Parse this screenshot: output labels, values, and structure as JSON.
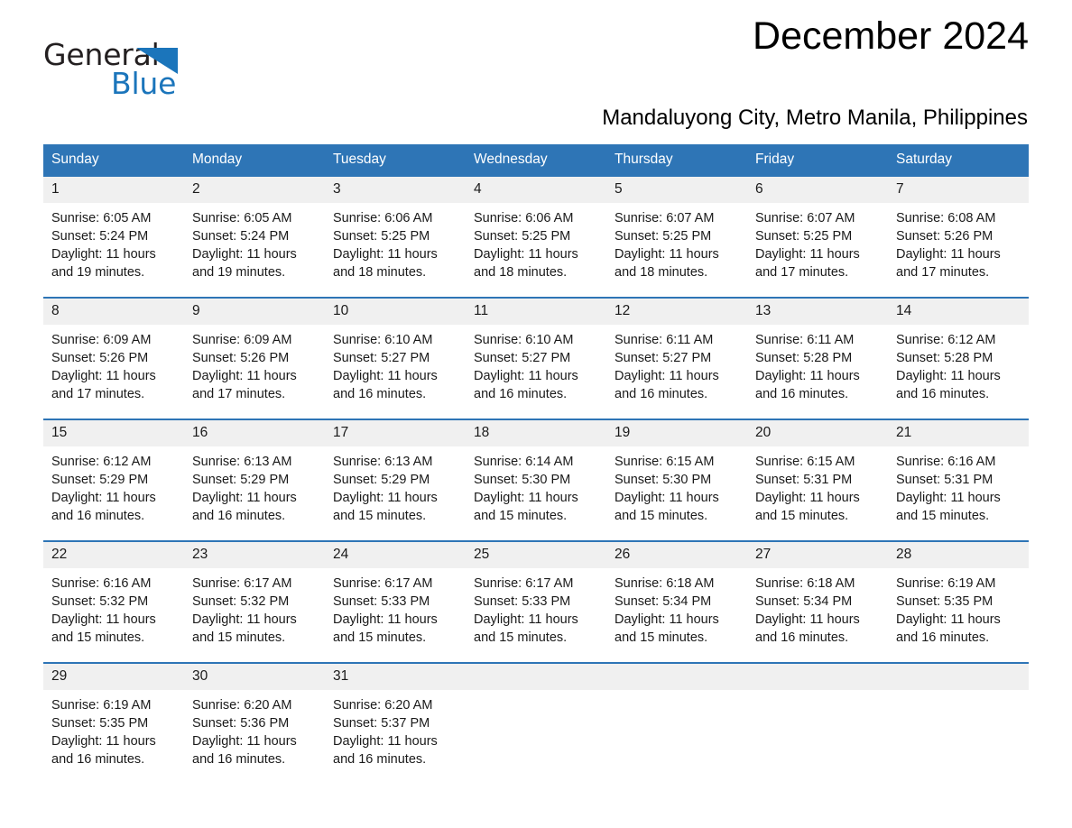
{
  "brand": {
    "name_part1": "General",
    "name_part2": "Blue",
    "logo_icon": "triangle-logo-icon",
    "accent_color": "#1b75bb"
  },
  "header": {
    "title": "December 2024",
    "subtitle": "Mandaluyong City, Metro Manila, Philippines"
  },
  "colors": {
    "header_blue": "#2e75b6",
    "daynum_band": "#f0f0f0",
    "text": "#1a1a1a"
  },
  "calendar": {
    "weekday_headers": [
      "Sunday",
      "Monday",
      "Tuesday",
      "Wednesday",
      "Thursday",
      "Friday",
      "Saturday"
    ],
    "weeks": [
      [
        {
          "day": "1",
          "sunrise": "Sunrise: 6:05 AM",
          "sunset": "Sunset: 5:24 PM",
          "daylight": "Daylight: 11 hours and 19 minutes."
        },
        {
          "day": "2",
          "sunrise": "Sunrise: 6:05 AM",
          "sunset": "Sunset: 5:24 PM",
          "daylight": "Daylight: 11 hours and 19 minutes."
        },
        {
          "day": "3",
          "sunrise": "Sunrise: 6:06 AM",
          "sunset": "Sunset: 5:25 PM",
          "daylight": "Daylight: 11 hours and 18 minutes."
        },
        {
          "day": "4",
          "sunrise": "Sunrise: 6:06 AM",
          "sunset": "Sunset: 5:25 PM",
          "daylight": "Daylight: 11 hours and 18 minutes."
        },
        {
          "day": "5",
          "sunrise": "Sunrise: 6:07 AM",
          "sunset": "Sunset: 5:25 PM",
          "daylight": "Daylight: 11 hours and 18 minutes."
        },
        {
          "day": "6",
          "sunrise": "Sunrise: 6:07 AM",
          "sunset": "Sunset: 5:25 PM",
          "daylight": "Daylight: 11 hours and 17 minutes."
        },
        {
          "day": "7",
          "sunrise": "Sunrise: 6:08 AM",
          "sunset": "Sunset: 5:26 PM",
          "daylight": "Daylight: 11 hours and 17 minutes."
        }
      ],
      [
        {
          "day": "8",
          "sunrise": "Sunrise: 6:09 AM",
          "sunset": "Sunset: 5:26 PM",
          "daylight": "Daylight: 11 hours and 17 minutes."
        },
        {
          "day": "9",
          "sunrise": "Sunrise: 6:09 AM",
          "sunset": "Sunset: 5:26 PM",
          "daylight": "Daylight: 11 hours and 17 minutes."
        },
        {
          "day": "10",
          "sunrise": "Sunrise: 6:10 AM",
          "sunset": "Sunset: 5:27 PM",
          "daylight": "Daylight: 11 hours and 16 minutes."
        },
        {
          "day": "11",
          "sunrise": "Sunrise: 6:10 AM",
          "sunset": "Sunset: 5:27 PM",
          "daylight": "Daylight: 11 hours and 16 minutes."
        },
        {
          "day": "12",
          "sunrise": "Sunrise: 6:11 AM",
          "sunset": "Sunset: 5:27 PM",
          "daylight": "Daylight: 11 hours and 16 minutes."
        },
        {
          "day": "13",
          "sunrise": "Sunrise: 6:11 AM",
          "sunset": "Sunset: 5:28 PM",
          "daylight": "Daylight: 11 hours and 16 minutes."
        },
        {
          "day": "14",
          "sunrise": "Sunrise: 6:12 AM",
          "sunset": "Sunset: 5:28 PM",
          "daylight": "Daylight: 11 hours and 16 minutes."
        }
      ],
      [
        {
          "day": "15",
          "sunrise": "Sunrise: 6:12 AM",
          "sunset": "Sunset: 5:29 PM",
          "daylight": "Daylight: 11 hours and 16 minutes."
        },
        {
          "day": "16",
          "sunrise": "Sunrise: 6:13 AM",
          "sunset": "Sunset: 5:29 PM",
          "daylight": "Daylight: 11 hours and 16 minutes."
        },
        {
          "day": "17",
          "sunrise": "Sunrise: 6:13 AM",
          "sunset": "Sunset: 5:29 PM",
          "daylight": "Daylight: 11 hours and 15 minutes."
        },
        {
          "day": "18",
          "sunrise": "Sunrise: 6:14 AM",
          "sunset": "Sunset: 5:30 PM",
          "daylight": "Daylight: 11 hours and 15 minutes."
        },
        {
          "day": "19",
          "sunrise": "Sunrise: 6:15 AM",
          "sunset": "Sunset: 5:30 PM",
          "daylight": "Daylight: 11 hours and 15 minutes."
        },
        {
          "day": "20",
          "sunrise": "Sunrise: 6:15 AM",
          "sunset": "Sunset: 5:31 PM",
          "daylight": "Daylight: 11 hours and 15 minutes."
        },
        {
          "day": "21",
          "sunrise": "Sunrise: 6:16 AM",
          "sunset": "Sunset: 5:31 PM",
          "daylight": "Daylight: 11 hours and 15 minutes."
        }
      ],
      [
        {
          "day": "22",
          "sunrise": "Sunrise: 6:16 AM",
          "sunset": "Sunset: 5:32 PM",
          "daylight": "Daylight: 11 hours and 15 minutes."
        },
        {
          "day": "23",
          "sunrise": "Sunrise: 6:17 AM",
          "sunset": "Sunset: 5:32 PM",
          "daylight": "Daylight: 11 hours and 15 minutes."
        },
        {
          "day": "24",
          "sunrise": "Sunrise: 6:17 AM",
          "sunset": "Sunset: 5:33 PM",
          "daylight": "Daylight: 11 hours and 15 minutes."
        },
        {
          "day": "25",
          "sunrise": "Sunrise: 6:17 AM",
          "sunset": "Sunset: 5:33 PM",
          "daylight": "Daylight: 11 hours and 15 minutes."
        },
        {
          "day": "26",
          "sunrise": "Sunrise: 6:18 AM",
          "sunset": "Sunset: 5:34 PM",
          "daylight": "Daylight: 11 hours and 15 minutes."
        },
        {
          "day": "27",
          "sunrise": "Sunrise: 6:18 AM",
          "sunset": "Sunset: 5:34 PM",
          "daylight": "Daylight: 11 hours and 16 minutes."
        },
        {
          "day": "28",
          "sunrise": "Sunrise: 6:19 AM",
          "sunset": "Sunset: 5:35 PM",
          "daylight": "Daylight: 11 hours and 16 minutes."
        }
      ],
      [
        {
          "day": "29",
          "sunrise": "Sunrise: 6:19 AM",
          "sunset": "Sunset: 5:35 PM",
          "daylight": "Daylight: 11 hours and 16 minutes."
        },
        {
          "day": "30",
          "sunrise": "Sunrise: 6:20 AM",
          "sunset": "Sunset: 5:36 PM",
          "daylight": "Daylight: 11 hours and 16 minutes."
        },
        {
          "day": "31",
          "sunrise": "Sunrise: 6:20 AM",
          "sunset": "Sunset: 5:37 PM",
          "daylight": "Daylight: 11 hours and 16 minutes."
        },
        {
          "day": "",
          "sunrise": "",
          "sunset": "",
          "daylight": ""
        },
        {
          "day": "",
          "sunrise": "",
          "sunset": "",
          "daylight": ""
        },
        {
          "day": "",
          "sunrise": "",
          "sunset": "",
          "daylight": ""
        },
        {
          "day": "",
          "sunrise": "",
          "sunset": "",
          "daylight": ""
        }
      ]
    ]
  }
}
